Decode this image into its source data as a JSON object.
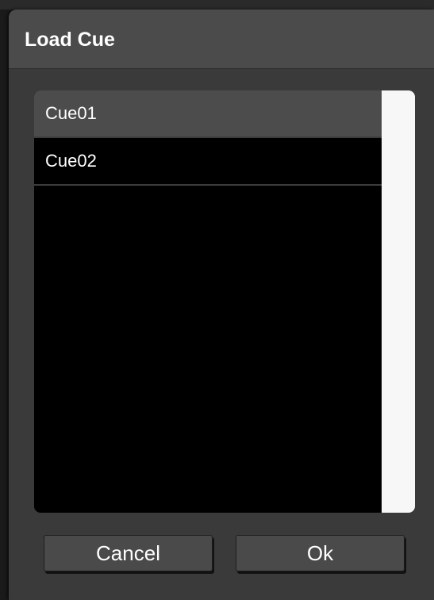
{
  "dialog": {
    "title": "Load Cue",
    "items": [
      {
        "label": "Cue01",
        "selected": true
      },
      {
        "label": "Cue02",
        "selected": false
      }
    ],
    "buttons": {
      "cancel_label": "Cancel",
      "ok_label": "Ok"
    }
  },
  "colors": {
    "dialog_bg": "#3a3a3a",
    "titlebar_bg": "#4b4b4b",
    "list_bg": "#000000",
    "selected_row": "#4c4c4c",
    "scrollbar": "#f7f7f7",
    "button_bg": "#4a4a4a",
    "text": "#ffffff"
  }
}
